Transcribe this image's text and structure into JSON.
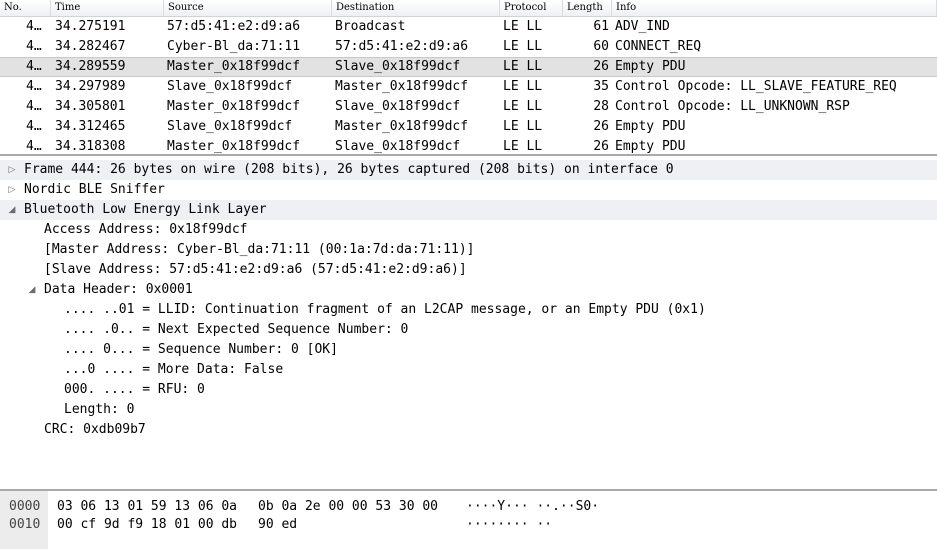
{
  "packet_list": {
    "columns": [
      "No.",
      "Time",
      "Source",
      "Destination",
      "Protocol",
      "Length",
      "Info"
    ],
    "rows": [
      {
        "no": "4…",
        "time": "34.275191",
        "source": "57:d5:41:e2:d9:a6",
        "destination": "Broadcast",
        "protocol": "LE LL",
        "length": "61",
        "info": "ADV_IND"
      },
      {
        "no": "4…",
        "time": "34.282467",
        "source": "Cyber-Bl_da:71:11",
        "destination": "57:d5:41:e2:d9:a6",
        "protocol": "LE LL",
        "length": "60",
        "info": "CONNECT_REQ"
      },
      {
        "no": "4…",
        "time": "34.289559",
        "source": "Master_0x18f99dcf",
        "destination": "Slave_0x18f99dcf",
        "protocol": "LE LL",
        "length": "26",
        "info": "Empty PDU"
      },
      {
        "no": "4…",
        "time": "34.297989",
        "source": "Slave_0x18f99dcf",
        "destination": "Master_0x18f99dcf",
        "protocol": "LE LL",
        "length": "35",
        "info": "Control Opcode: LL_SLAVE_FEATURE_REQ"
      },
      {
        "no": "4…",
        "time": "34.305801",
        "source": "Master_0x18f99dcf",
        "destination": "Slave_0x18f99dcf",
        "protocol": "LE LL",
        "length": "28",
        "info": "Control Opcode: LL_UNKNOWN_RSP"
      },
      {
        "no": "4…",
        "time": "34.312465",
        "source": "Slave_0x18f99dcf",
        "destination": "Master_0x18f99dcf",
        "protocol": "LE LL",
        "length": "26",
        "info": "Empty PDU"
      },
      {
        "no": "4…",
        "time": "34.318308",
        "source": "Master_0x18f99dcf",
        "destination": "Slave_0x18f99dcf",
        "protocol": "LE LL",
        "length": "26",
        "info": "Empty PDU"
      }
    ],
    "selected_index": 2
  },
  "details": {
    "rows": [
      {
        "text": "Frame 444: 26 bytes on wire (208 bits), 26 bytes captured (208 bits) on interface 0",
        "indent": 0,
        "expander": "collapsed",
        "shaded": true
      },
      {
        "text": "Nordic BLE Sniffer",
        "indent": 0,
        "expander": "collapsed",
        "shaded": false
      },
      {
        "text": "Bluetooth Low Energy Link Layer",
        "indent": 0,
        "expander": "expanded",
        "shaded": true
      },
      {
        "text": "Access Address: 0x18f99dcf",
        "indent": 1,
        "expander": "none",
        "shaded": false
      },
      {
        "text": "[Master Address: Cyber-Bl_da:71:11 (00:1a:7d:da:71:11)]",
        "indent": 1,
        "expander": "none",
        "shaded": false
      },
      {
        "text": "[Slave Address: 57:d5:41:e2:d9:a6 (57:d5:41:e2:d9:a6)]",
        "indent": 1,
        "expander": "none",
        "shaded": false
      },
      {
        "text": "Data Header: 0x0001",
        "indent": 1,
        "expander": "expanded",
        "shaded": false
      },
      {
        "text": ".... ..01 = LLID: Continuation fragment of an L2CAP message, or an Empty PDU (0x1)",
        "indent": 2,
        "expander": "none",
        "shaded": false
      },
      {
        "text": ".... .0.. = Next Expected Sequence Number: 0",
        "indent": 2,
        "expander": "none",
        "shaded": false
      },
      {
        "text": ".... 0... = Sequence Number: 0 [OK]",
        "indent": 2,
        "expander": "none",
        "shaded": false
      },
      {
        "text": "...0 .... = More Data: False",
        "indent": 2,
        "expander": "none",
        "shaded": false
      },
      {
        "text": "000. .... = RFU: 0",
        "indent": 2,
        "expander": "none",
        "shaded": false
      },
      {
        "text": "Length: 0",
        "indent": 2,
        "expander": "none",
        "shaded": false
      },
      {
        "text": "CRC: 0xdb09b7",
        "indent": 1,
        "expander": "none",
        "shaded": false
      }
    ]
  },
  "bytes": {
    "rows": [
      {
        "offset": "0000",
        "hex1": "03 06 13 01 59 13 06 0a",
        "hex2": "0b 0a 2e 00 00 53 30 00",
        "ascii": "····Y··· ··.··S0·"
      },
      {
        "offset": "0010",
        "hex1": "00 cf 9d f9 18 01 00 db",
        "hex2": "90 ed",
        "ascii": "········ ··"
      }
    ]
  },
  "icons": {
    "collapsed": "triangle-right-icon",
    "expanded": "triangle-down-icon"
  },
  "colors": {
    "selected_row": "#e2e2e2",
    "shaded_row": "#eef0f3",
    "offset_gutter": "#ececec"
  }
}
